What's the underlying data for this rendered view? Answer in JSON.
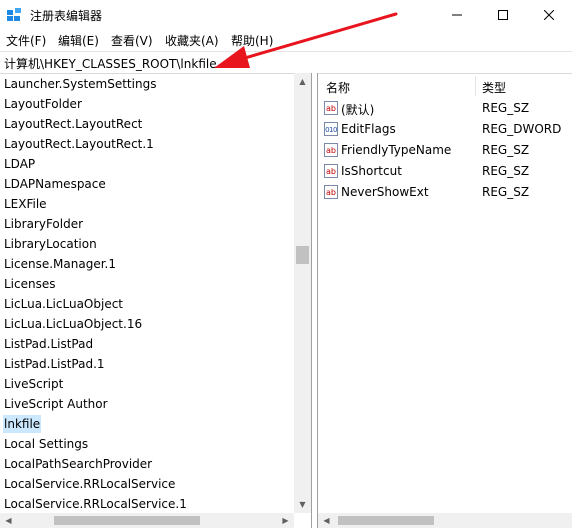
{
  "window": {
    "title": "注册表编辑器"
  },
  "menu": [
    "文件(F)",
    "编辑(E)",
    "查看(V)",
    "收藏夹(A)",
    "帮助(H)"
  ],
  "address": "计算机\\HKEY_CLASSES_ROOT\\lnkfile",
  "tree": [
    "Launcher.SystemSettings",
    "LayoutFolder",
    "LayoutRect.LayoutRect",
    "LayoutRect.LayoutRect.1",
    "LDAP",
    "LDAPNamespace",
    "LEXFile",
    "LibraryFolder",
    "LibraryLocation",
    "License.Manager.1",
    "Licenses",
    "LicLua.LicLuaObject",
    "LicLua.LicLuaObject.16",
    "ListPad.ListPad",
    "ListPad.ListPad.1",
    "LiveScript",
    "LiveScript Author",
    "lnkfile",
    "Local Settings",
    "LocalPathSearchProvider",
    "LocalService.RRLocalService",
    "LocalService.RRLocalService.1"
  ],
  "selected_tree_item": "lnkfile",
  "list": {
    "headers": {
      "name": "名称",
      "type": "类型"
    },
    "rows": [
      {
        "name": "(默认)",
        "type": "REG_SZ",
        "icon": "string-value-icon"
      },
      {
        "name": "EditFlags",
        "type": "REG_DWORD",
        "icon": "binary-value-icon"
      },
      {
        "name": "FriendlyTypeName",
        "type": "REG_SZ",
        "icon": "string-value-icon"
      },
      {
        "name": "IsShortcut",
        "type": "REG_SZ",
        "icon": "string-value-icon"
      },
      {
        "name": "NeverShowExt",
        "type": "REG_SZ",
        "icon": "string-value-icon"
      }
    ]
  },
  "icons": {
    "app": "regedit-icon",
    "minimize": "minimize-icon",
    "maximize": "maximize-icon",
    "close": "close-icon",
    "annotation": "red-arrow-annotation"
  },
  "colors": {
    "selection": "#cce8ff",
    "arrow": "#e8141e"
  }
}
